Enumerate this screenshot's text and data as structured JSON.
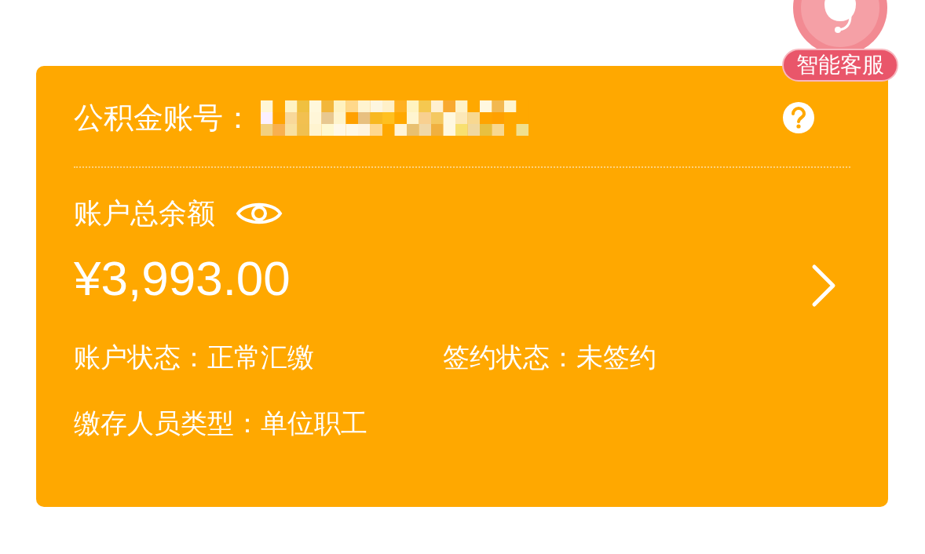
{
  "service_badge": {
    "label": "智能客服"
  },
  "account": {
    "label": "公积金账号："
  },
  "balance": {
    "label": "账户总余额",
    "amount": "¥3,993.00"
  },
  "details": [
    {
      "label": "账户状态：",
      "value": "正常汇缴"
    },
    {
      "label": "签约状态：",
      "value": "未签约"
    },
    {
      "label": "缴存人员类型：",
      "value": "单位职工"
    }
  ]
}
